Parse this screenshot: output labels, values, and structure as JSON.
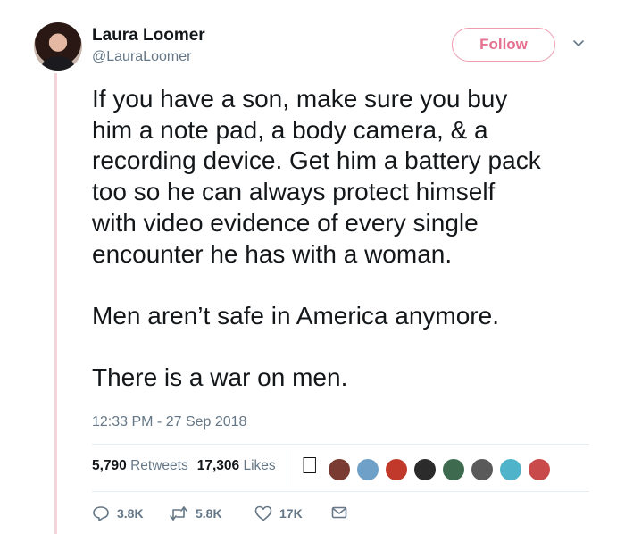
{
  "user": {
    "name": "Laura Loomer",
    "handle": "@LauraLoomer"
  },
  "header": {
    "follow_label": "Follow",
    "menu_icon": "chevron-down-icon"
  },
  "tweet": {
    "text": "If you have a son, make sure you buy\nhim a note pad, a body camera, & a\nrecording device. Get him a battery pack\ntoo so he can always protect himself\nwith video evidence of every single\nencounter he has with a woman.\n\nMen aren’t safe in America anymore.\n\nThere is a war on men.",
    "timestamp": "12:33 PM - 27 Sep 2018"
  },
  "stats": {
    "retweets_count": "5,790",
    "retweets_label": "Retweets",
    "likes_count": "17,306",
    "likes_label": "Likes"
  },
  "likers": [
    {
      "icon": "apple-logo-icon",
      "color": "#111111"
    },
    {
      "icon": "avatar",
      "color": "#7a3b32"
    },
    {
      "icon": "avatar",
      "color": "#6fa0c8"
    },
    {
      "icon": "avatar",
      "color": "#c0392b"
    },
    {
      "icon": "avatar",
      "color": "#2b2b2b"
    },
    {
      "icon": "avatar",
      "color": "#3e6b4f"
    },
    {
      "icon": "avatar",
      "color": "#5a5a5a"
    },
    {
      "icon": "avatar",
      "color": "#4fb3c9"
    },
    {
      "icon": "avatar",
      "color": "#c94a4a"
    }
  ],
  "actions": {
    "replies": "3.8K",
    "retweets": "5.8K",
    "likes": "17K"
  },
  "colors": {
    "follow_accent": "#e56f8f",
    "thread_line": "#f5d4dc",
    "secondary_text": "#657786"
  }
}
